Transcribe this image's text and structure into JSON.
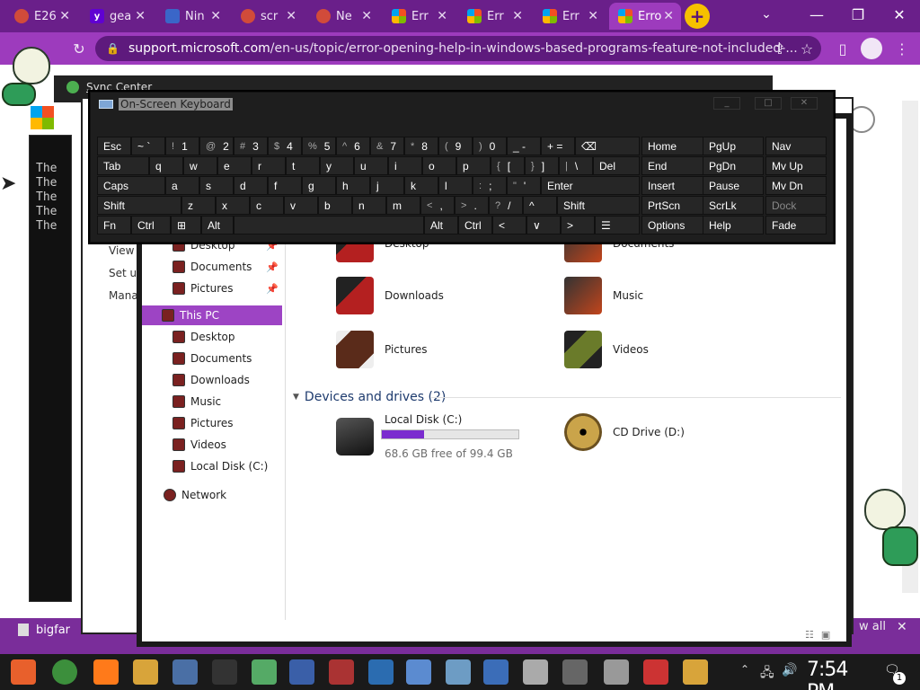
{
  "browser": {
    "tabs": [
      {
        "title": "E26",
        "icon": "chrome-icon"
      },
      {
        "title": "gea",
        "icon": "yahoo-icon"
      },
      {
        "title": "Nin",
        "icon": "app-icon"
      },
      {
        "title": "scr",
        "icon": "chrome-icon"
      },
      {
        "title": "Ne",
        "icon": "chrome-icon"
      },
      {
        "title": "Err",
        "icon": "windows-icon"
      },
      {
        "title": "Err",
        "icon": "windows-icon"
      },
      {
        "title": "Err",
        "icon": "windows-icon"
      },
      {
        "title": "Erro",
        "icon": "windows-icon",
        "active": true
      }
    ],
    "new_tab_label": "+",
    "address": {
      "domain": "support.microsoft.com",
      "path": "/en-us/topic/error-opening-help-in-windows-based-programs-feature-not-included-..."
    },
    "download_item": "bigfar",
    "show_all": "w all"
  },
  "background": {
    "cmd_lines": [
      "The",
      "The",
      "The",
      "The",
      "The"
    ],
    "sync_center_title": "Sync Center",
    "control_panel_links": [
      "View",
      "Set u",
      "Manag"
    ]
  },
  "explorer": {
    "nav_items": [
      {
        "label": "Desktop",
        "pinned": true
      },
      {
        "label": "Documents",
        "pinned": true
      },
      {
        "label": "Pictures",
        "pinned": true
      },
      {
        "label": "This PC",
        "selected": true
      },
      {
        "label": "Desktop"
      },
      {
        "label": "Documents"
      },
      {
        "label": "Downloads"
      },
      {
        "label": "Music"
      },
      {
        "label": "Pictures"
      },
      {
        "label": "Videos"
      },
      {
        "label": "Local Disk (C:)"
      },
      {
        "label": "Network"
      }
    ],
    "folders": [
      {
        "label": "Desktop",
        "icon": "desktop-folder-icon"
      },
      {
        "label": "Documents",
        "icon": "documents-folder-icon"
      },
      {
        "label": "Downloads",
        "icon": "downloads-folder-icon"
      },
      {
        "label": "Music",
        "icon": "music-folder-icon"
      },
      {
        "label": "Pictures",
        "icon": "pictures-folder-icon"
      },
      {
        "label": "Videos",
        "icon": "videos-folder-icon"
      }
    ],
    "devices_header": "Devices and drives (2)",
    "drives": [
      {
        "label": "Local Disk (C:)",
        "detail": "68.6 GB free of 99.4 GB",
        "used_fraction": 0.31
      },
      {
        "label": "CD Drive (D:)"
      }
    ]
  },
  "osk": {
    "title": "On-Screen Keyboard",
    "rows": [
      [
        {
          "label": "Esc"
        },
        {
          "label": "~ `"
        },
        {
          "sub": "!",
          "label": "1"
        },
        {
          "sub": "@",
          "label": "2"
        },
        {
          "sub": "#",
          "label": "3"
        },
        {
          "sub": "$",
          "label": "4"
        },
        {
          "sub": "%",
          "label": "5"
        },
        {
          "sub": "^",
          "label": "6"
        },
        {
          "sub": "&",
          "label": "7"
        },
        {
          "sub": "*",
          "label": "8"
        },
        {
          "sub": "(",
          "label": "9"
        },
        {
          "sub": ")",
          "label": "0"
        },
        {
          "label": "_ -"
        },
        {
          "label": "+ ="
        },
        {
          "label": "⌫"
        },
        {
          "label": "Home"
        },
        {
          "label": "PgUp"
        },
        {
          "label": "Nav"
        }
      ],
      [
        {
          "label": "Tab"
        },
        {
          "label": "q"
        },
        {
          "label": "w"
        },
        {
          "label": "e"
        },
        {
          "label": "r"
        },
        {
          "label": "t"
        },
        {
          "label": "y"
        },
        {
          "label": "u"
        },
        {
          "label": "i"
        },
        {
          "label": "o"
        },
        {
          "label": "p"
        },
        {
          "sub": "{",
          "label": "["
        },
        {
          "sub": "}",
          "label": "]"
        },
        {
          "sub": "|",
          "label": "\\"
        },
        {
          "label": "Del"
        },
        {
          "label": "End"
        },
        {
          "label": "PgDn"
        },
        {
          "label": "Mv Up"
        }
      ],
      [
        {
          "label": "Caps"
        },
        {
          "label": "a"
        },
        {
          "label": "s"
        },
        {
          "label": "d"
        },
        {
          "label": "f"
        },
        {
          "label": "g"
        },
        {
          "label": "h"
        },
        {
          "label": "j"
        },
        {
          "label": "k"
        },
        {
          "label": "l"
        },
        {
          "sub": ":",
          "label": ";"
        },
        {
          "sub": "\"",
          "label": "'"
        },
        {
          "label": "Enter"
        },
        {
          "label": "Insert"
        },
        {
          "label": "Pause"
        },
        {
          "label": "Mv Dn"
        }
      ],
      [
        {
          "label": "Shift"
        },
        {
          "label": "z"
        },
        {
          "label": "x"
        },
        {
          "label": "c"
        },
        {
          "label": "v"
        },
        {
          "label": "b"
        },
        {
          "label": "n"
        },
        {
          "label": "m"
        },
        {
          "sub": "<",
          "label": ","
        },
        {
          "sub": ">",
          "label": "."
        },
        {
          "sub": "?",
          "label": "/"
        },
        {
          "label": "^"
        },
        {
          "label": "Shift"
        },
        {
          "label": "PrtScn"
        },
        {
          "label": "ScrLk"
        },
        {
          "label": "Dock",
          "dim": true
        }
      ],
      [
        {
          "label": "Fn"
        },
        {
          "label": "Ctrl"
        },
        {
          "label": "⊞"
        },
        {
          "label": "Alt"
        },
        {
          "label": ""
        },
        {
          "label": "Alt"
        },
        {
          "label": "Ctrl"
        },
        {
          "label": "<"
        },
        {
          "label": "∨"
        },
        {
          "label": ">"
        },
        {
          "label": "☰"
        },
        {
          "label": "Options"
        },
        {
          "label": "Help"
        },
        {
          "label": "Fade"
        }
      ]
    ]
  },
  "taskbar": {
    "clock": "7:54 PM",
    "notification_count": "1",
    "apps": [
      "start",
      "chrome",
      "firefox",
      "file-explorer",
      "computer",
      "peridot",
      "app",
      "network",
      "app",
      "app",
      "app",
      "app",
      "app",
      "app",
      "app",
      "app",
      "app",
      "app",
      "folder"
    ]
  },
  "colors": {
    "accent_purple": "#9d3bbd",
    "dark_purple": "#6a1f8a",
    "selection_purple": "#9d44c4",
    "disk_fill": "#7b2ccf"
  }
}
